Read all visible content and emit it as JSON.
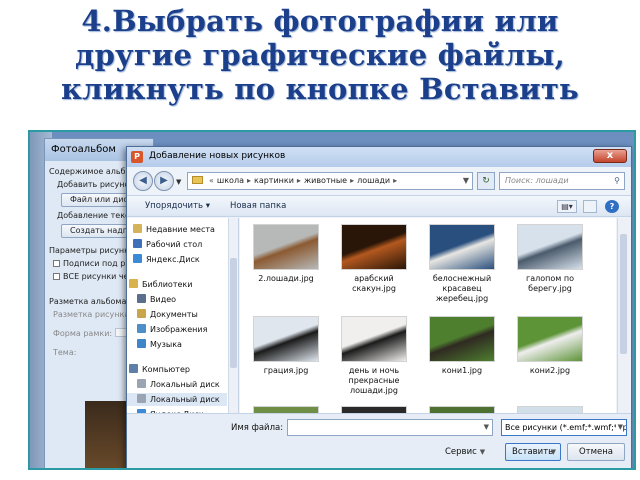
{
  "slide": {
    "title_lines": [
      "4.Выбрать  фотографии или",
      "другие графические файлы,",
      "кликнуть по кнопке Вставить"
    ]
  },
  "album_window": {
    "title": "Фотоальбом",
    "lines": {
      "content": "Содержимое альбома",
      "add_picture": "Добавить рисунок",
      "file_button": "Файл или диск...",
      "add_text": "Добавление текста",
      "create_button": "Создать надпись",
      "picture_params": "Параметры рисунка",
      "captions": "Подписи под рисунками",
      "all_bw": "ВСЕ рисунки черно-белые",
      "layout": "Разметка альбома",
      "layout_field": "Разметка рисунка",
      "frame_field": "Форма рамки:",
      "theme_field": "Тема:"
    }
  },
  "dialog": {
    "title": "Добавление новых рисунков",
    "close": "x",
    "app_icon": "P",
    "breadcrumb": [
      "школа",
      "картинки",
      "животные",
      "лошади"
    ],
    "search_placeholder": "Поиск: лошади",
    "toolbar": {
      "organize": "Упорядочить ▾",
      "new_folder": "Новая папка"
    },
    "nav_items": [
      {
        "label": "Недавние места",
        "icon": "recent-places-icon",
        "color": "#d5b35a"
      },
      {
        "label": "Рабочий стол",
        "icon": "desktop-icon",
        "color": "#3e6fb8"
      },
      {
        "label": "Яндекс.Диск",
        "icon": "yandex-disk-icon",
        "color": "#3a8ad8"
      },
      {
        "label": "Библиотеки",
        "icon": "libraries-icon",
        "color": "#d8b24c"
      },
      {
        "label": "Видео",
        "icon": "video-icon",
        "color": "#5a6f8e"
      },
      {
        "label": "Документы",
        "icon": "documents-icon",
        "color": "#c9a64a"
      },
      {
        "label": "Изображения",
        "icon": "images-icon",
        "color": "#4f8fc8"
      },
      {
        "label": "Музыка",
        "icon": "music-icon",
        "color": "#3e86c7"
      },
      {
        "label": "Компьютер",
        "icon": "computer-icon",
        "color": "#5f7fa8"
      },
      {
        "label": "Локальный диск",
        "icon": "local-disk-icon",
        "color": "#9aa4b2"
      },
      {
        "label": "Локальный диск",
        "icon": "local-disk-icon",
        "color": "#9aa4b2"
      },
      {
        "label": "Яндекс.Диск",
        "icon": "yandex-disk-icon",
        "color": "#3a8ad8"
      }
    ],
    "files": [
      {
        "name": "2.лошади.jpg",
        "colors": [
          "#b7b9b8",
          "#8b5a32"
        ]
      },
      {
        "name": "арабский скакун.jpg",
        "colors": [
          "#2a1608",
          "#b3581f"
        ]
      },
      {
        "name": "белоснежный красавец жеребец.jpg",
        "colors": [
          "#294f7e",
          "#e8e6e2"
        ]
      },
      {
        "name": "галопом по берегу.jpg",
        "colors": [
          "#d7e1ec",
          "#4b5b6c"
        ]
      },
      {
        "name": "грация.jpg",
        "colors": [
          "#dfe6ee",
          "#1a1a1a"
        ]
      },
      {
        "name": "день и ночь прекрасные лошади.jpg",
        "colors": [
          "#f0efed",
          "#1b1b1b"
        ]
      },
      {
        "name": "кони1.jpg",
        "colors": [
          "#4e7f2e",
          "#2f2a22"
        ]
      },
      {
        "name": "кони2.jpg",
        "colors": [
          "#5d9437",
          "#eeeeee"
        ]
      },
      {
        "name": "",
        "colors": [
          "#6f8e46",
          "#a5c07a"
        ]
      },
      {
        "name": "",
        "colors": [
          "#2a2a2a",
          "#6b5a44"
        ]
      },
      {
        "name": "",
        "colors": [
          "#4e7031",
          "#2e3f22"
        ]
      },
      {
        "name": "",
        "colors": [
          "#d1dfe9",
          "#8aa2b4"
        ]
      }
    ],
    "filename_label": "Имя файла:",
    "filename_value": "",
    "filter": "Все рисунки (*.emf;*.wmf;*.jpg",
    "service": "Сервис",
    "insert": "Вставить",
    "cancel": "Отмена"
  }
}
